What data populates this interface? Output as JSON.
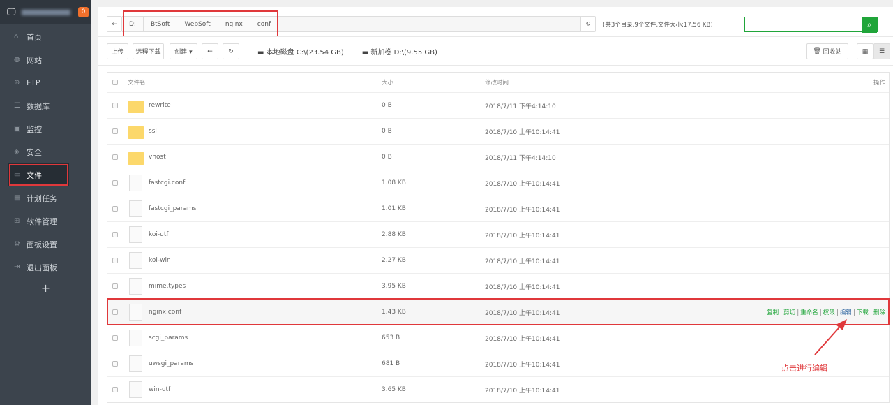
{
  "sidebar": {
    "badge": "0",
    "items": [
      {
        "icon": "home-icon",
        "g": "⌂",
        "label": "首页"
      },
      {
        "icon": "globe-icon",
        "g": "◍",
        "label": "网站"
      },
      {
        "icon": "ftp-icon",
        "g": "⊕",
        "label": "FTP"
      },
      {
        "icon": "database-icon",
        "g": "☰",
        "label": "数据库"
      },
      {
        "icon": "monitor-icon",
        "g": "▣",
        "label": "监控"
      },
      {
        "icon": "shield-icon",
        "g": "◈",
        "label": "安全"
      },
      {
        "icon": "folder-icon",
        "g": "▭",
        "label": "文件"
      },
      {
        "icon": "calendar-icon",
        "g": "▤",
        "label": "计划任务"
      },
      {
        "icon": "apps-icon",
        "g": "⊞",
        "label": "软件管理"
      },
      {
        "icon": "gear-icon",
        "g": "⚙",
        "label": "面板设置"
      },
      {
        "icon": "logout-icon",
        "g": "⇥",
        "label": "退出面板"
      }
    ],
    "add": "+"
  },
  "breadcrumb": [
    "D:",
    "BtSoft",
    "WebSoft",
    "nginx",
    "conf"
  ],
  "summary": "(共3个目录,9个文件,文件大小:17.56 KB)",
  "toolbar": {
    "upload": "上传",
    "remote": "远程下载",
    "create": "创建 ▾",
    "back": "←",
    "refresh": "↻",
    "recycle": "回收站"
  },
  "disks": [
    "本地磁盘 C:\\(23.54 GB)",
    "新加卷 D:\\(9.55 GB)"
  ],
  "table": {
    "headers": {
      "name": "文件名",
      "size": "大小",
      "time": "修改时间",
      "op": "操作"
    },
    "rows": [
      {
        "name": "rewrite",
        "size": "0 B",
        "time": "2018/7/11 下午4:14:10",
        "type": "folder"
      },
      {
        "name": "ssl",
        "size": "0 B",
        "time": "2018/7/10 上午10:14:41",
        "type": "folder"
      },
      {
        "name": "vhost",
        "size": "0 B",
        "time": "2018/7/11 下午4:14:10",
        "type": "folder"
      },
      {
        "name": "fastcgi.conf",
        "size": "1.08 KB",
        "time": "2018/7/10 上午10:14:41",
        "type": "file"
      },
      {
        "name": "fastcgi_params",
        "size": "1.01 KB",
        "time": "2018/7/10 上午10:14:41",
        "type": "file"
      },
      {
        "name": "koi-utf",
        "size": "2.88 KB",
        "time": "2018/7/10 上午10:14:41",
        "type": "file"
      },
      {
        "name": "koi-win",
        "size": "2.27 KB",
        "time": "2018/7/10 上午10:14:41",
        "type": "file"
      },
      {
        "name": "mime.types",
        "size": "3.95 KB",
        "time": "2018/7/10 上午10:14:41",
        "type": "file"
      },
      {
        "name": "nginx.conf",
        "size": "1.43 KB",
        "time": "2018/7/10 上午10:14:41",
        "type": "file",
        "hover": true
      },
      {
        "name": "scgi_params",
        "size": "653 B",
        "time": "2018/7/10 上午10:14:41",
        "type": "file"
      },
      {
        "name": "uwsgi_params",
        "size": "681 B",
        "time": "2018/7/10 上午10:14:41",
        "type": "file"
      },
      {
        "name": "win-utf",
        "size": "3.65 KB",
        "time": "2018/7/10 上午10:14:41",
        "type": "file"
      }
    ]
  },
  "ops": [
    "复制",
    "剪切",
    "重命名",
    "权限",
    "编辑",
    "下载",
    "删除"
  ],
  "annotation": "点击进行编辑",
  "colors": {
    "accent": "#20a53a",
    "highlight": "#e0383b"
  }
}
